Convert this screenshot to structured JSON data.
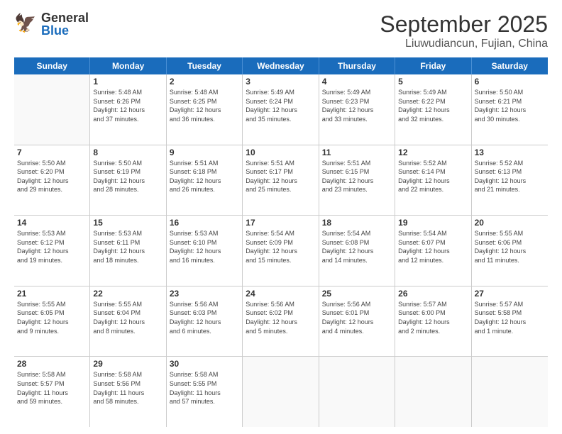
{
  "header": {
    "logo_general": "General",
    "logo_blue": "Blue",
    "title": "September 2025",
    "subtitle": "Liuwudiancun, Fujian, China"
  },
  "days_of_week": [
    "Sunday",
    "Monday",
    "Tuesday",
    "Wednesday",
    "Thursday",
    "Friday",
    "Saturday"
  ],
  "weeks": [
    [
      {
        "day": "",
        "info": ""
      },
      {
        "day": "1",
        "info": "Sunrise: 5:48 AM\nSunset: 6:26 PM\nDaylight: 12 hours\nand 37 minutes."
      },
      {
        "day": "2",
        "info": "Sunrise: 5:48 AM\nSunset: 6:25 PM\nDaylight: 12 hours\nand 36 minutes."
      },
      {
        "day": "3",
        "info": "Sunrise: 5:49 AM\nSunset: 6:24 PM\nDaylight: 12 hours\nand 35 minutes."
      },
      {
        "day": "4",
        "info": "Sunrise: 5:49 AM\nSunset: 6:23 PM\nDaylight: 12 hours\nand 33 minutes."
      },
      {
        "day": "5",
        "info": "Sunrise: 5:49 AM\nSunset: 6:22 PM\nDaylight: 12 hours\nand 32 minutes."
      },
      {
        "day": "6",
        "info": "Sunrise: 5:50 AM\nSunset: 6:21 PM\nDaylight: 12 hours\nand 30 minutes."
      }
    ],
    [
      {
        "day": "7",
        "info": "Sunrise: 5:50 AM\nSunset: 6:20 PM\nDaylight: 12 hours\nand 29 minutes."
      },
      {
        "day": "8",
        "info": "Sunrise: 5:50 AM\nSunset: 6:19 PM\nDaylight: 12 hours\nand 28 minutes."
      },
      {
        "day": "9",
        "info": "Sunrise: 5:51 AM\nSunset: 6:18 PM\nDaylight: 12 hours\nand 26 minutes."
      },
      {
        "day": "10",
        "info": "Sunrise: 5:51 AM\nSunset: 6:17 PM\nDaylight: 12 hours\nand 25 minutes."
      },
      {
        "day": "11",
        "info": "Sunrise: 5:51 AM\nSunset: 6:15 PM\nDaylight: 12 hours\nand 23 minutes."
      },
      {
        "day": "12",
        "info": "Sunrise: 5:52 AM\nSunset: 6:14 PM\nDaylight: 12 hours\nand 22 minutes."
      },
      {
        "day": "13",
        "info": "Sunrise: 5:52 AM\nSunset: 6:13 PM\nDaylight: 12 hours\nand 21 minutes."
      }
    ],
    [
      {
        "day": "14",
        "info": "Sunrise: 5:53 AM\nSunset: 6:12 PM\nDaylight: 12 hours\nand 19 minutes."
      },
      {
        "day": "15",
        "info": "Sunrise: 5:53 AM\nSunset: 6:11 PM\nDaylight: 12 hours\nand 18 minutes."
      },
      {
        "day": "16",
        "info": "Sunrise: 5:53 AM\nSunset: 6:10 PM\nDaylight: 12 hours\nand 16 minutes."
      },
      {
        "day": "17",
        "info": "Sunrise: 5:54 AM\nSunset: 6:09 PM\nDaylight: 12 hours\nand 15 minutes."
      },
      {
        "day": "18",
        "info": "Sunrise: 5:54 AM\nSunset: 6:08 PM\nDaylight: 12 hours\nand 14 minutes."
      },
      {
        "day": "19",
        "info": "Sunrise: 5:54 AM\nSunset: 6:07 PM\nDaylight: 12 hours\nand 12 minutes."
      },
      {
        "day": "20",
        "info": "Sunrise: 5:55 AM\nSunset: 6:06 PM\nDaylight: 12 hours\nand 11 minutes."
      }
    ],
    [
      {
        "day": "21",
        "info": "Sunrise: 5:55 AM\nSunset: 6:05 PM\nDaylight: 12 hours\nand 9 minutes."
      },
      {
        "day": "22",
        "info": "Sunrise: 5:55 AM\nSunset: 6:04 PM\nDaylight: 12 hours\nand 8 minutes."
      },
      {
        "day": "23",
        "info": "Sunrise: 5:56 AM\nSunset: 6:03 PM\nDaylight: 12 hours\nand 6 minutes."
      },
      {
        "day": "24",
        "info": "Sunrise: 5:56 AM\nSunset: 6:02 PM\nDaylight: 12 hours\nand 5 minutes."
      },
      {
        "day": "25",
        "info": "Sunrise: 5:56 AM\nSunset: 6:01 PM\nDaylight: 12 hours\nand 4 minutes."
      },
      {
        "day": "26",
        "info": "Sunrise: 5:57 AM\nSunset: 6:00 PM\nDaylight: 12 hours\nand 2 minutes."
      },
      {
        "day": "27",
        "info": "Sunrise: 5:57 AM\nSunset: 5:58 PM\nDaylight: 12 hours\nand 1 minute."
      }
    ],
    [
      {
        "day": "28",
        "info": "Sunrise: 5:58 AM\nSunset: 5:57 PM\nDaylight: 11 hours\nand 59 minutes."
      },
      {
        "day": "29",
        "info": "Sunrise: 5:58 AM\nSunset: 5:56 PM\nDaylight: 11 hours\nand 58 minutes."
      },
      {
        "day": "30",
        "info": "Sunrise: 5:58 AM\nSunset: 5:55 PM\nDaylight: 11 hours\nand 57 minutes."
      },
      {
        "day": "",
        "info": ""
      },
      {
        "day": "",
        "info": ""
      },
      {
        "day": "",
        "info": ""
      },
      {
        "day": "",
        "info": ""
      }
    ]
  ]
}
